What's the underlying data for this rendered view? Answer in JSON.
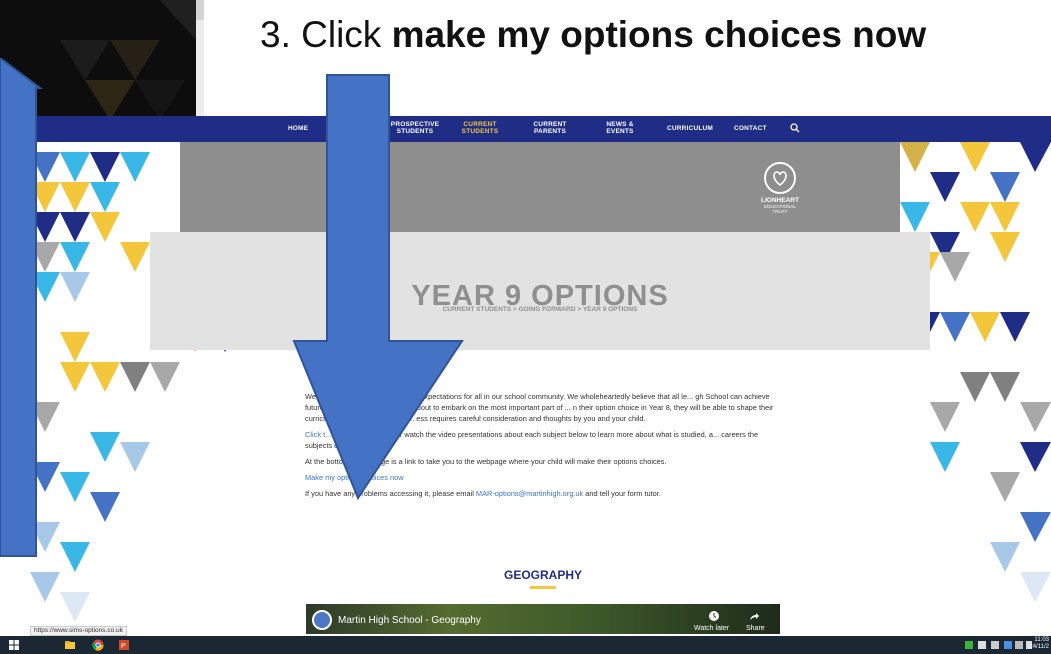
{
  "slide": {
    "instruction_prefix": "3. Click ",
    "instruction_bold": "make my options choices now"
  },
  "nav": {
    "items": [
      {
        "label": "HOME",
        "active": false
      },
      {
        "label": "PROSPECTIVE STUDENTS",
        "active": false
      },
      {
        "label": "CURRENT STUDENTS",
        "active": true
      },
      {
        "label": "CURRENT PARENTS",
        "active": false
      },
      {
        "label": "NEWS & EVENTS",
        "active": false
      },
      {
        "label": "CURRICULUM",
        "active": false
      },
      {
        "label": "CONTACT",
        "active": false
      }
    ],
    "search_icon": "search-icon"
  },
  "logo": {
    "name": "LIONHEART",
    "sub1": "EDUCATIONAL",
    "sub2": "TRUST"
  },
  "hero": {
    "title": "YEAR 9 OPTIONS",
    "breadcrumb": "CURRENT STUDENTS > GOING FORWARD > YEAR 9 OPTIONS"
  },
  "content": {
    "p1": "We a... our learners and have high expectations for all in our school community. We wholeheartedly believe that all le... gh School can achieve future success. Our learners are about to embark on the most important part of ... n their option choice in Year 8, they will be able to shape their curriculum and match it to their ... ess requires careful consideration and thoughts by you and your child.",
    "p2_link": "Click t... ur options booklet",
    "p2_rest": ", or watch the video presentations about each subject below to learn more about what is studied, a... careers the subjects can lead to.",
    "p3": "At the bottom of this page is a link to take you to the webpage where your child will make their options choices.",
    "p4_link": "Make my options choices now",
    "p5_prefix": "If you have any problems accessing it, please email ",
    "p5_email": "MAR-options@martinhigh.org.uk",
    "p5_suffix": " and tell your form tutor."
  },
  "section": {
    "title": "GEOGRAPHY"
  },
  "video": {
    "title": "Martin High School - Geography",
    "watch_later": "Watch later",
    "share": "Share"
  },
  "status_url": "https://www.sims-options.co.uk",
  "taskbar": {
    "time": "11:03",
    "date": "24/11/2"
  },
  "colors": {
    "nav_bg": "#1f2d86",
    "active_nav": "#f3c63b",
    "arrow_fill": "#4472c4",
    "link": "#3a74c4"
  }
}
